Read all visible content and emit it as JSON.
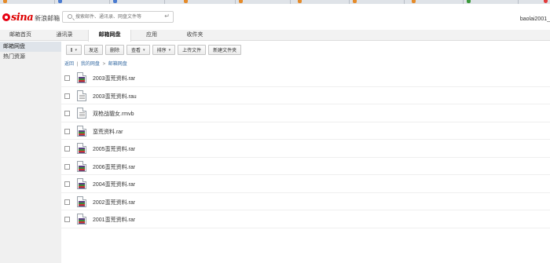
{
  "brand": {
    "word": "sina",
    "product": "新浪邮箱"
  },
  "search": {
    "placeholder": "搜索邮件、通讯录、网盘文件等",
    "enter_glyph": "↵"
  },
  "user": {
    "name": "baolai2001_"
  },
  "nav": {
    "tabs": [
      {
        "label": "邮箱首页",
        "active": false
      },
      {
        "label": "通讯录",
        "active": false
      },
      {
        "label": "邮箱网盘",
        "active": true
      },
      {
        "label": "应用",
        "active": false
      },
      {
        "label": "收件夹",
        "active": false
      }
    ]
  },
  "sidebar": {
    "items": [
      {
        "label": "邮箱网盘",
        "active": true
      },
      {
        "label": "热门资源",
        "active": false
      }
    ]
  },
  "toolbar": {
    "select_caret": "▾",
    "send": "发送",
    "delete": "删除",
    "view": "查看",
    "sort": "排序",
    "upload": "上传文件",
    "new_folder": "新建文件夹"
  },
  "breadcrumb": {
    "back": "返回",
    "sep1": "|",
    "root": "我的网盘",
    "sep2": ">",
    "current": "邮箱网盘"
  },
  "files": [
    {
      "name": "2003蛮荒资料.rar",
      "icon": "archive-icon"
    },
    {
      "name": "2003蛮荒资料.rau",
      "icon": "document-icon"
    },
    {
      "name": "双枪战貔女.rmvb",
      "icon": "document-icon"
    },
    {
      "name": "蛮荒资料.rar",
      "icon": "archive-icon"
    },
    {
      "name": "2005蛮荒资料.rar",
      "icon": "archive-icon"
    },
    {
      "name": "2006蛮荒资料.rar",
      "icon": "archive-icon"
    },
    {
      "name": "2004蛮荒资料.rar",
      "icon": "archive-icon"
    },
    {
      "name": "2002蛮荒资料.rar",
      "icon": "archive-icon"
    },
    {
      "name": "2001蛮荒资料.rar",
      "icon": "archive-icon"
    }
  ],
  "colors": {
    "brand_red": "#e60012",
    "link_blue": "#3a6ea5",
    "close_red": "#e23b3b"
  }
}
